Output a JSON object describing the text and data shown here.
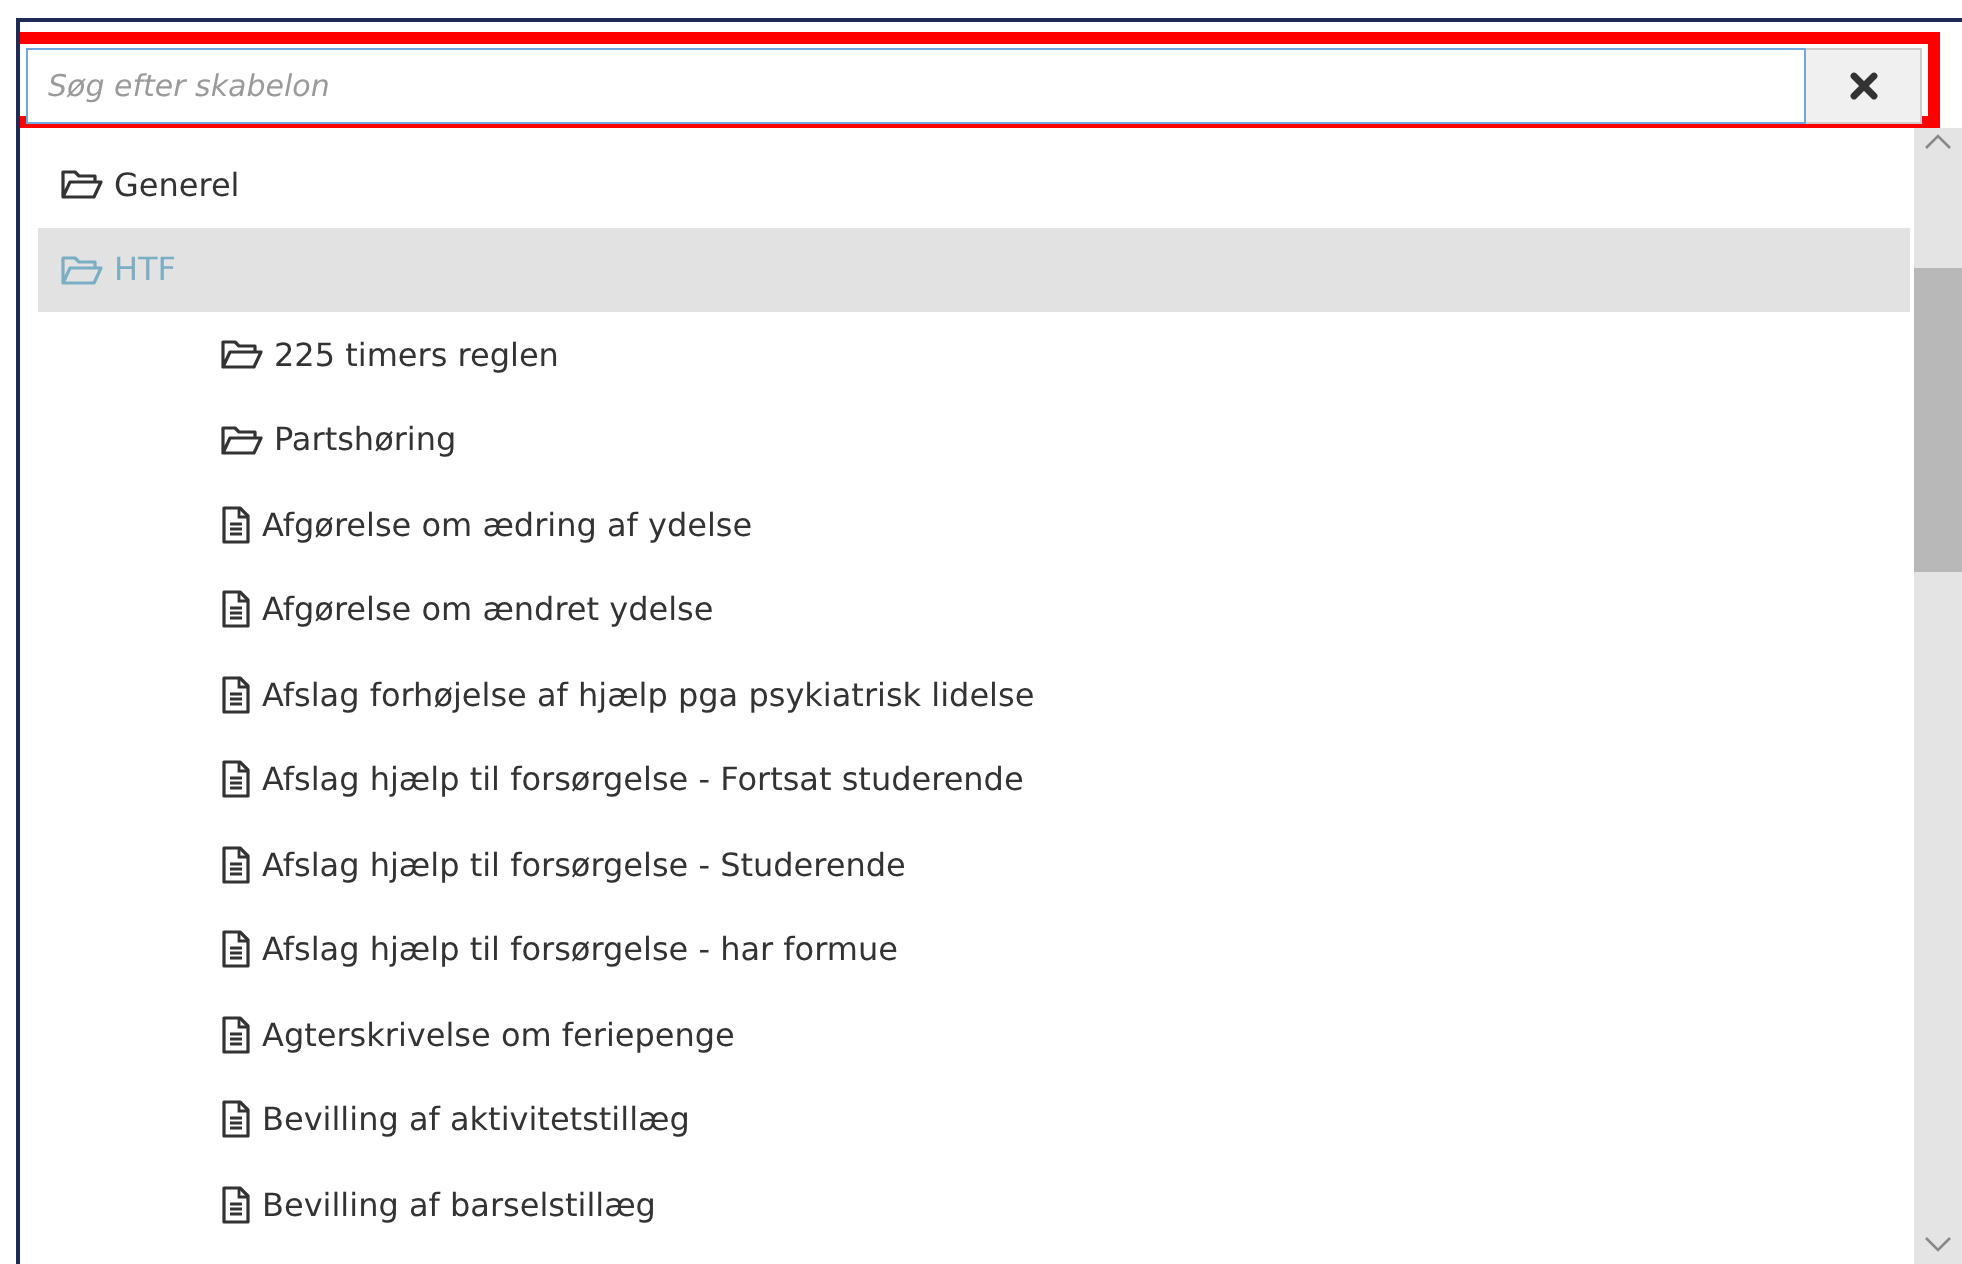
{
  "search": {
    "placeholder": "Søg efter skabelon",
    "highlighted": true
  },
  "tree": [
    {
      "label": "Generel",
      "kind": "folder",
      "selected": false
    },
    {
      "label": "HTF",
      "kind": "folder",
      "selected": true,
      "children": [
        {
          "label": "225 timers reglen",
          "kind": "folder",
          "selected": false
        },
        {
          "label": "Partshøring",
          "kind": "folder",
          "selected": false
        },
        {
          "label": "Afgørelse om ædring af ydelse",
          "kind": "document",
          "selected": false
        },
        {
          "label": "Afgørelse om ændret ydelse",
          "kind": "document",
          "selected": false
        },
        {
          "label": "Afslag forhøjelse af hjælp pga psykiatrisk lidelse",
          "kind": "document",
          "selected": false
        },
        {
          "label": "Afslag hjælp til forsørgelse - Fortsat studerende",
          "kind": "document",
          "selected": false
        },
        {
          "label": "Afslag hjælp til forsørgelse - Studerende",
          "kind": "document",
          "selected": false
        },
        {
          "label": "Afslag hjælp til forsørgelse - har formue",
          "kind": "document",
          "selected": false
        },
        {
          "label": "Agterskrivelse om feriepenge",
          "kind": "document",
          "selected": false
        },
        {
          "label": "Bevilling af aktivitetstillæg",
          "kind": "document",
          "selected": false
        },
        {
          "label": "Bevilling af barselstillæg",
          "kind": "document",
          "selected": false
        }
      ]
    }
  ]
}
